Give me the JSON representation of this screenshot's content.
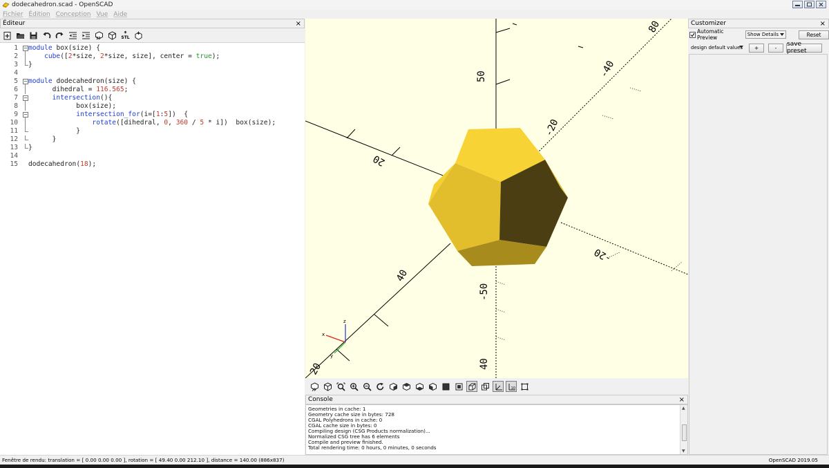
{
  "window": {
    "title": "dodecahedron.scad - OpenSCAD"
  },
  "menu": [
    "Fichier",
    "Édition",
    "Conception",
    "Vue",
    "Aide"
  ],
  "editor": {
    "title": "Éditeur",
    "toolbar_icons": [
      "new-file-icon",
      "open-file-icon",
      "save-file-icon",
      "undo-icon",
      "redo-icon",
      "unindent-icon",
      "indent-icon",
      "preview-icon",
      "render-icon",
      "export-stl-icon",
      "send-to-3d-print-icon"
    ],
    "stl_label": "STL",
    "lines": [
      {
        "n": "1",
        "fold": "box",
        "code": [
          {
            "t": "module ",
            "c": "kw"
          },
          {
            "t": "box(size)",
            "c": "pl"
          },
          {
            "t": " {",
            "c": "pl"
          }
        ]
      },
      {
        "n": "2",
        "fold": "line",
        "code": [
          {
            "t": "    cube",
            "c": "fn"
          },
          {
            "t": "([",
            "c": "pl"
          },
          {
            "t": "2",
            "c": "num"
          },
          {
            "t": "*size, ",
            "c": "pl"
          },
          {
            "t": "2",
            "c": "num"
          },
          {
            "t": "*size, size], center = ",
            "c": "pl"
          },
          {
            "t": "true",
            "c": "str"
          },
          {
            "t": ");",
            "c": "pl"
          }
        ]
      },
      {
        "n": "3",
        "fold": "end",
        "code": [
          {
            "t": "}",
            "c": "pl"
          }
        ]
      },
      {
        "n": "4",
        "fold": "",
        "code": []
      },
      {
        "n": "5",
        "fold": "box",
        "code": [
          {
            "t": "module ",
            "c": "kw"
          },
          {
            "t": "dodecahedron(size)",
            "c": "pl"
          },
          {
            "t": " {",
            "c": "pl"
          }
        ]
      },
      {
        "n": "6",
        "fold": "line",
        "code": [
          {
            "t": "      dihedral = ",
            "c": "pl"
          },
          {
            "t": "116.565",
            "c": "num"
          },
          {
            "t": ";",
            "c": "pl"
          }
        ]
      },
      {
        "n": "7",
        "fold": "box",
        "code": [
          {
            "t": "      intersection",
            "c": "fn"
          },
          {
            "t": "(){",
            "c": "pl"
          }
        ]
      },
      {
        "n": "8",
        "fold": "line",
        "code": [
          {
            "t": "            box",
            "c": "pl"
          },
          {
            "t": "(size);",
            "c": "pl"
          }
        ]
      },
      {
        "n": "9",
        "fold": "box",
        "code": [
          {
            "t": "            intersection_for",
            "c": "fn"
          },
          {
            "t": "(i=[",
            "c": "pl"
          },
          {
            "t": "1",
            "c": "num"
          },
          {
            "t": ":",
            "c": "pl"
          },
          {
            "t": "5",
            "c": "num"
          },
          {
            "t": "])  {",
            "c": "pl"
          }
        ]
      },
      {
        "n": "10",
        "fold": "line",
        "code": [
          {
            "t": "                rotate",
            "c": "fn"
          },
          {
            "t": "([dihedral, ",
            "c": "pl"
          },
          {
            "t": "0",
            "c": "num"
          },
          {
            "t": ", ",
            "c": "pl"
          },
          {
            "t": "360",
            "c": "num"
          },
          {
            "t": " / ",
            "c": "pl"
          },
          {
            "t": "5",
            "c": "num"
          },
          {
            "t": " * i])  box(size);",
            "c": "pl"
          }
        ]
      },
      {
        "n": "11",
        "fold": "end",
        "code": [
          {
            "t": "            }",
            "c": "pl"
          }
        ]
      },
      {
        "n": "12",
        "fold": "end",
        "code": [
          {
            "t": "      }",
            "c": "pl"
          }
        ]
      },
      {
        "n": "13",
        "fold": "end",
        "code": [
          {
            "t": "}",
            "c": "pl"
          }
        ]
      },
      {
        "n": "14",
        "fold": "",
        "code": []
      },
      {
        "n": "15",
        "fold": "",
        "code": [
          {
            "t": "dodecahedron",
            "c": "pl"
          },
          {
            "t": "(",
            "c": "pl"
          },
          {
            "t": "18",
            "c": "num"
          },
          {
            "t": ");",
            "c": "pl"
          }
        ]
      }
    ]
  },
  "viewport": {
    "background": "#ffffe5",
    "axis_labels": [
      "50",
      "-50",
      "-20",
      "20",
      "-40",
      "40",
      "80",
      "-20",
      "20",
      "-50",
      "40"
    ],
    "model_colors": {
      "top": "#f7d335",
      "left": "#e2bd2c",
      "right": "#4b3e12",
      "bottom": "#a88b1d"
    },
    "gizmo": {
      "x": "x",
      "y": "y",
      "z": "z"
    }
  },
  "view_toolbar": {
    "icons": [
      "preview-icon",
      "render-icon",
      "view-all-icon",
      "zoom-in-icon",
      "zoom-out-icon",
      "reset-view-icon",
      "view-right-icon",
      "view-top-icon",
      "view-bottom-icon",
      "view-left-icon",
      "view-front-icon",
      "view-back-icon",
      "perspective-icon",
      "orthogonal-icon",
      "show-axes-icon",
      "show-scale-markers-icon",
      "show-edges-icon"
    ],
    "scale_label": "10"
  },
  "console": {
    "title": "Console",
    "lines": [
      "Geometries in cache: 1",
      "Geometry cache size in bytes: 728",
      "CGAL Polyhedrons in cache: 0",
      "CGAL cache size in bytes: 0",
      "Compiling design (CSG Products normalization)...",
      "Normalized CSG tree has 6 elements",
      "Compile and preview finished.",
      "Total rendering time: 0 hours, 0 minutes, 0 seconds"
    ]
  },
  "customizer": {
    "title": "Customizer",
    "auto_preview_label": "Automatic Preview",
    "auto_preview_checked": true,
    "details_select": "Show Details",
    "reset_label": "Reset",
    "preset_select": "design default values",
    "add_label": "+",
    "remove_label": "-",
    "save_preset_label": "save preset"
  },
  "status": {
    "left": "Fenêtre de rendu: translation = [ 0.00 0.00 0.00 ], rotation = [ 49.40 0.00 212.10 ], distance = 140.00 (886x837)",
    "right": "OpenSCAD 2019.05"
  },
  "close_glyph": "×"
}
